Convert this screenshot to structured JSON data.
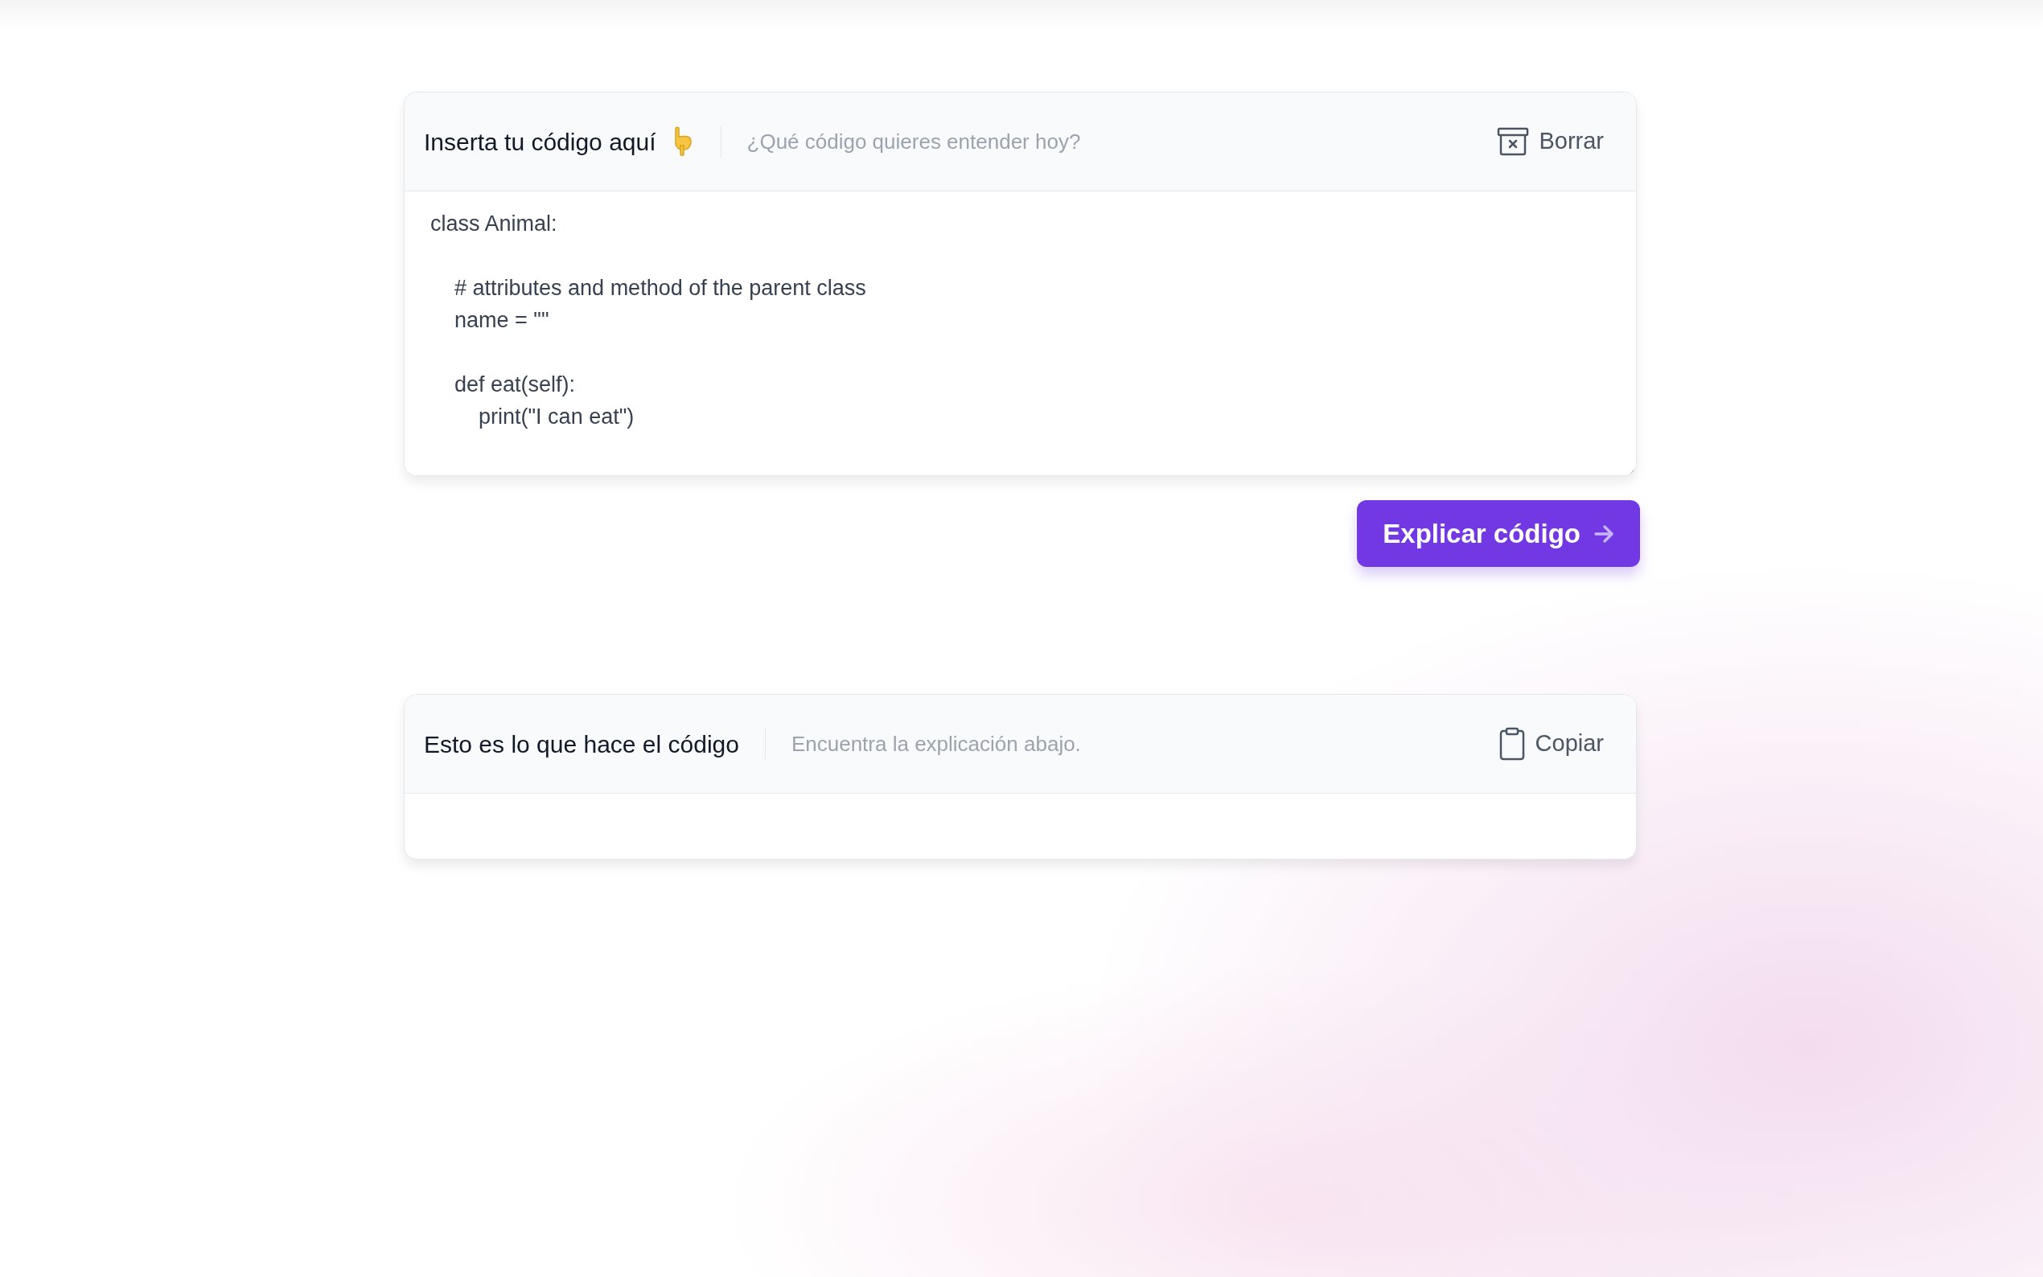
{
  "input_card": {
    "title": "Inserta tu código aquí",
    "subtitle": "¿Qué código quieres entender hoy?",
    "clear_button": "Borrar",
    "code": "class Animal:\n\n    # attributes and method of the parent class\n    name = \"\"\n\n    def eat(self):\n        print(\"I can eat\")"
  },
  "explain_button": "Explicar código",
  "output_card": {
    "title": "Esto es lo que hace el código",
    "subtitle": "Encuentra la explicación abajo.",
    "copy_button": "Copiar"
  }
}
